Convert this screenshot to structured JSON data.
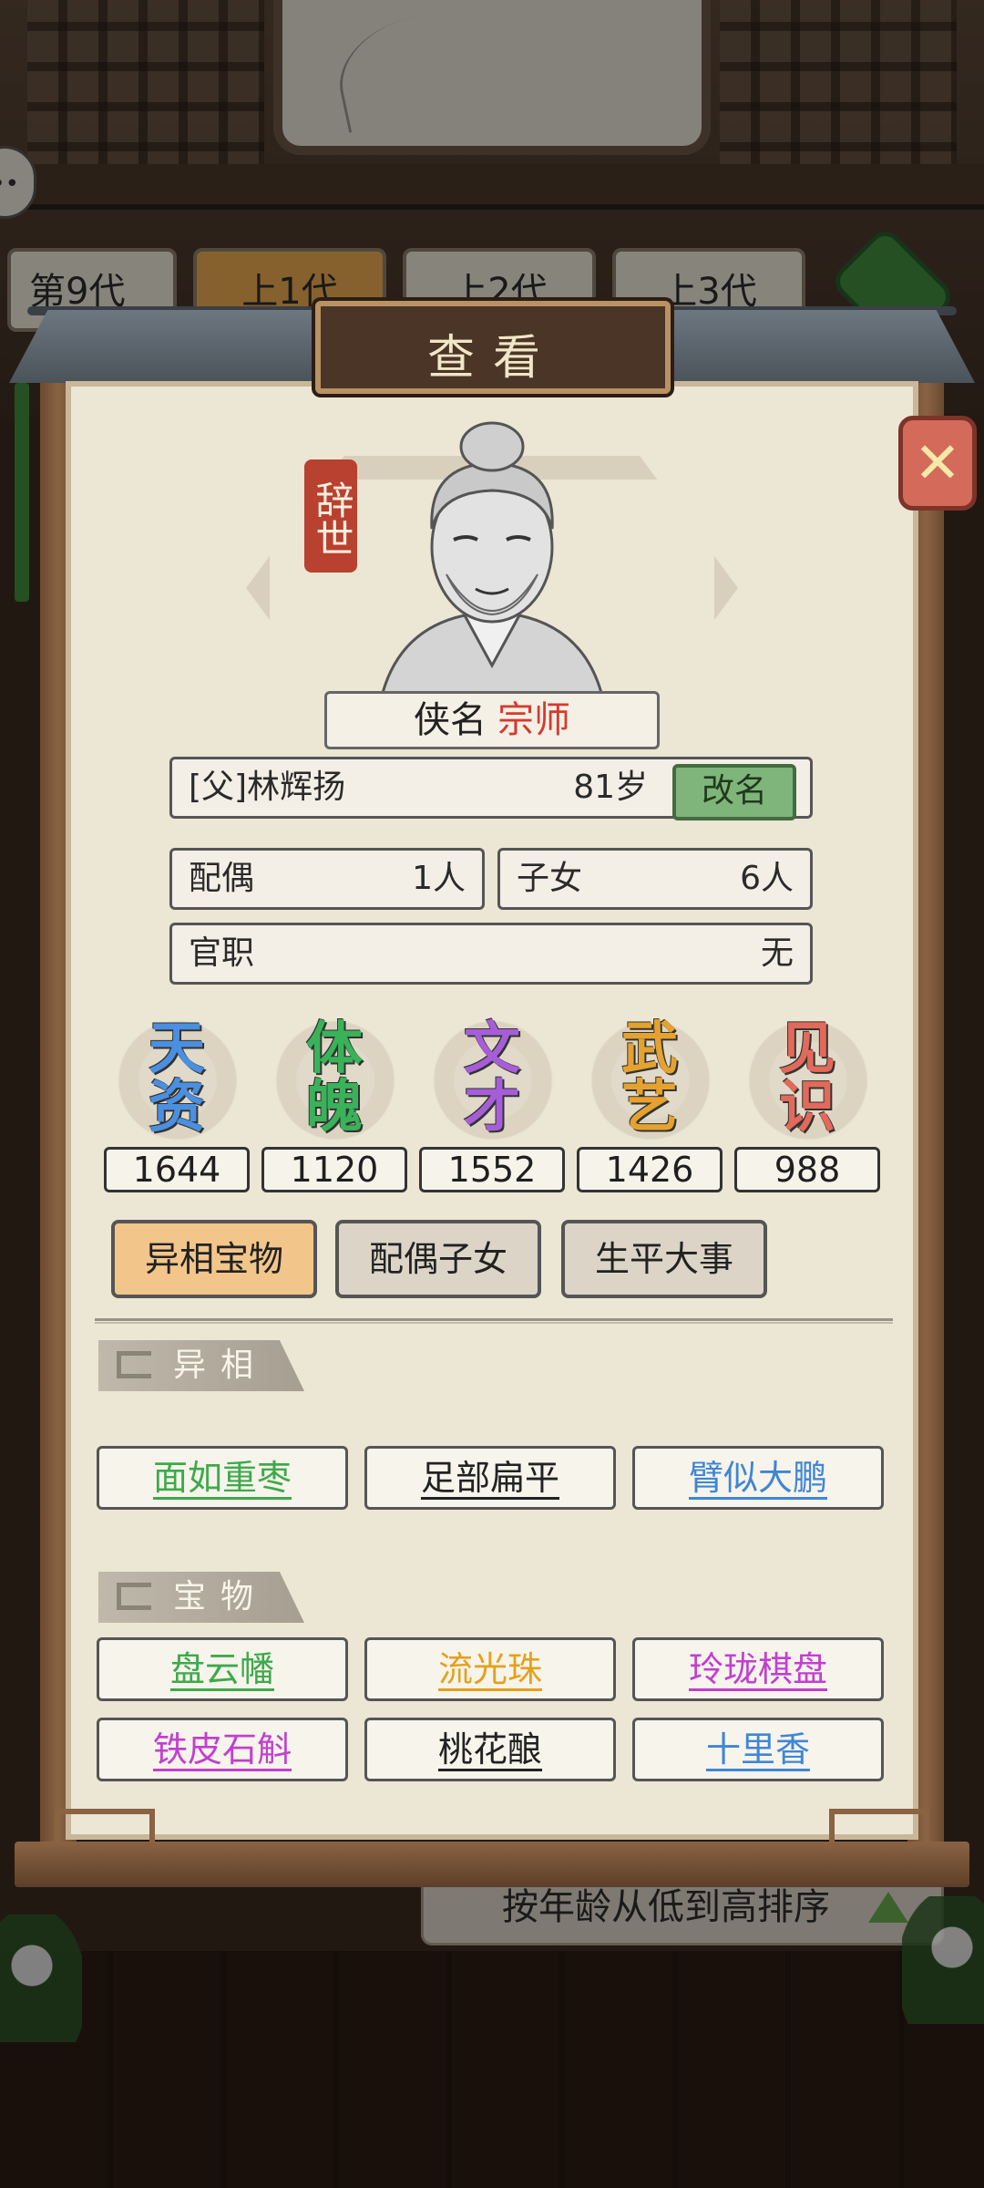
{
  "background": {
    "generation_tabs": [
      "第9代",
      "上1代",
      "上2代",
      "上3代"
    ],
    "sort_label": "按年龄从低到高排序",
    "chat_icon_text": "••"
  },
  "dialog": {
    "title": "查看",
    "status_stamp": "辞世",
    "title_label": "侠名",
    "title_value": "宗师",
    "name": "[父]林辉扬",
    "age": "81岁",
    "rename_label": "改名",
    "spouse_label": "配偶",
    "spouse_value": "1人",
    "children_label": "子女",
    "children_value": "6人",
    "office_label": "官职",
    "office_value": "无"
  },
  "stats": [
    {
      "label": "天资",
      "value": "1644",
      "color": "#4a8fe0"
    },
    {
      "label": "体魄",
      "value": "1120",
      "color": "#39b25a"
    },
    {
      "label": "文才",
      "value": "1552",
      "color": "#a65ed8"
    },
    {
      "label": "武艺",
      "value": "1426",
      "color": "#e5a22f"
    },
    {
      "label": "见识",
      "value": "988",
      "color": "#e26a5a"
    }
  ],
  "tabs": [
    {
      "label": "异相宝物",
      "active": true
    },
    {
      "label": "配偶子女",
      "active": false
    },
    {
      "label": "生平大事",
      "active": false
    }
  ],
  "traits_section": {
    "title": "异相",
    "items": [
      {
        "label": "面如重枣",
        "color": "#3daa4a"
      },
      {
        "label": "足部扁平",
        "color": "#222222"
      },
      {
        "label": "臂似大鹏",
        "color": "#3f86d6"
      }
    ]
  },
  "treasures_section": {
    "title": "宝物",
    "items": [
      {
        "label": "盘云幡",
        "color": "#3daa4a"
      },
      {
        "label": "流光珠",
        "color": "#e5a11a"
      },
      {
        "label": "玲珑棋盘",
        "color": "#c23fd0"
      },
      {
        "label": "铁皮石斛",
        "color": "#c23fd0"
      },
      {
        "label": "桃花酿",
        "color": "#222222"
      },
      {
        "label": "十里香",
        "color": "#3f86d6"
      }
    ]
  }
}
